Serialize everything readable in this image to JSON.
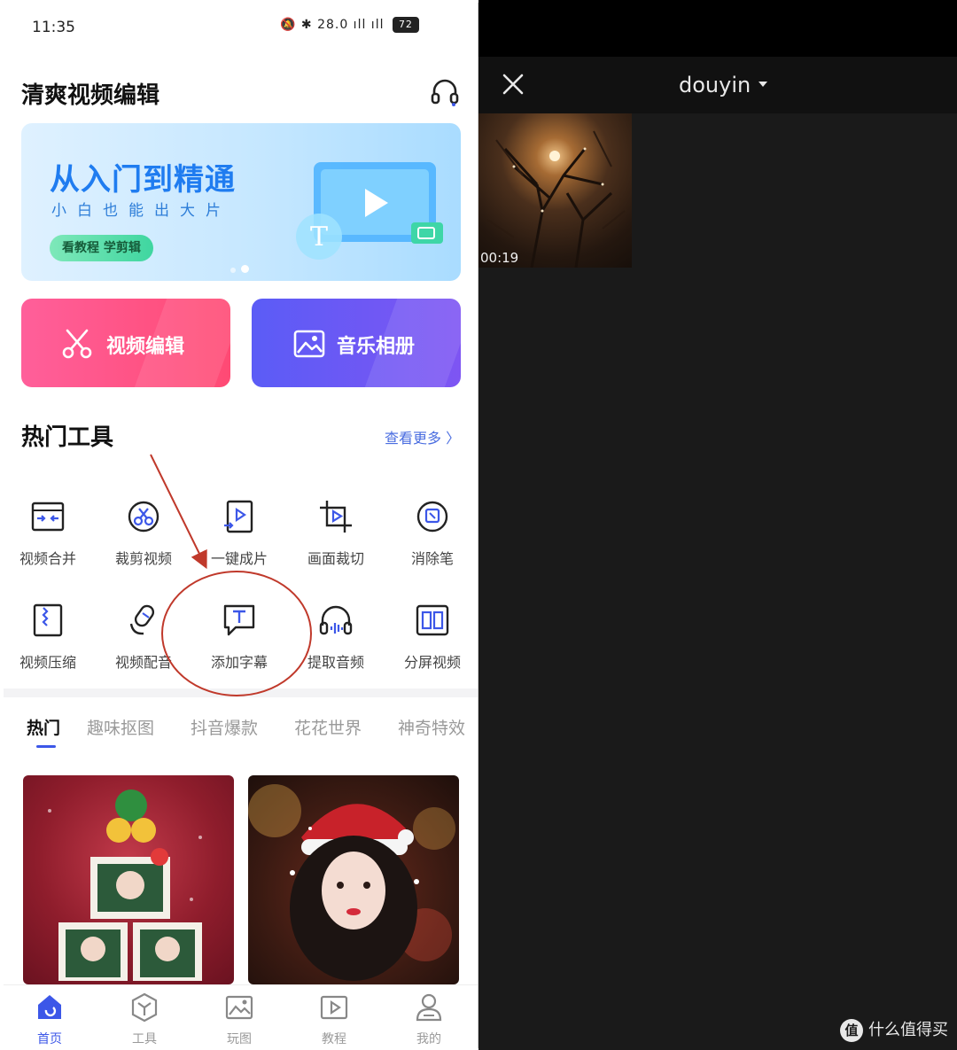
{
  "left_app": {
    "status_bar": {
      "time": "11:35",
      "icons": "🔕 ✱ 28.0 ıll ıll",
      "battery": "72"
    },
    "title": "清爽视频编辑",
    "banner": {
      "title": "从入门到精通",
      "subtitle": "小白也能出大片",
      "button": "看教程 学剪辑",
      "art_letter": "T"
    },
    "feature_cards": [
      {
        "label": "视频编辑",
        "icon": "scissors-icon"
      },
      {
        "label": "音乐相册",
        "icon": "image-icon"
      }
    ],
    "hot_tools": {
      "title": "热门工具",
      "more": "查看更多 〉",
      "items": [
        {
          "label": "视频合并",
          "icon": "merge-icon"
        },
        {
          "label": "裁剪视频",
          "icon": "cut-video-icon"
        },
        {
          "label": "一键成片",
          "icon": "one-click-icon"
        },
        {
          "label": "画面裁切",
          "icon": "crop-icon"
        },
        {
          "label": "消除笔",
          "icon": "eraser-icon"
        },
        {
          "label": "视频压缩",
          "icon": "compress-icon"
        },
        {
          "label": "视频配音",
          "icon": "dubbing-icon"
        },
        {
          "label": "添加字幕",
          "icon": "subtitle-icon"
        },
        {
          "label": "提取音频",
          "icon": "extract-audio-icon"
        },
        {
          "label": "分屏视频",
          "icon": "split-screen-icon"
        }
      ]
    },
    "category_tabs": [
      "热门",
      "趣味抠图",
      "抖音爆款",
      "花花世界",
      "神奇特效"
    ],
    "active_tab": "热门",
    "bottom_nav": [
      {
        "label": "首页",
        "icon": "home-icon"
      },
      {
        "label": "工具",
        "icon": "tools-icon"
      },
      {
        "label": "玩图",
        "icon": "picture-icon"
      },
      {
        "label": "教程",
        "icon": "tutorial-icon"
      },
      {
        "label": "我的",
        "icon": "profile-icon"
      }
    ],
    "active_nav": "首页"
  },
  "right_app": {
    "title": "douyin",
    "video": {
      "duration": "00:19"
    }
  },
  "watermark": {
    "badge": "值",
    "text": "什么值得买"
  },
  "colors": {
    "accent": "#3c57e8",
    "card_red": "#ff4a74",
    "card_blue": "#6a57f4",
    "annotation": "#c0392b"
  }
}
